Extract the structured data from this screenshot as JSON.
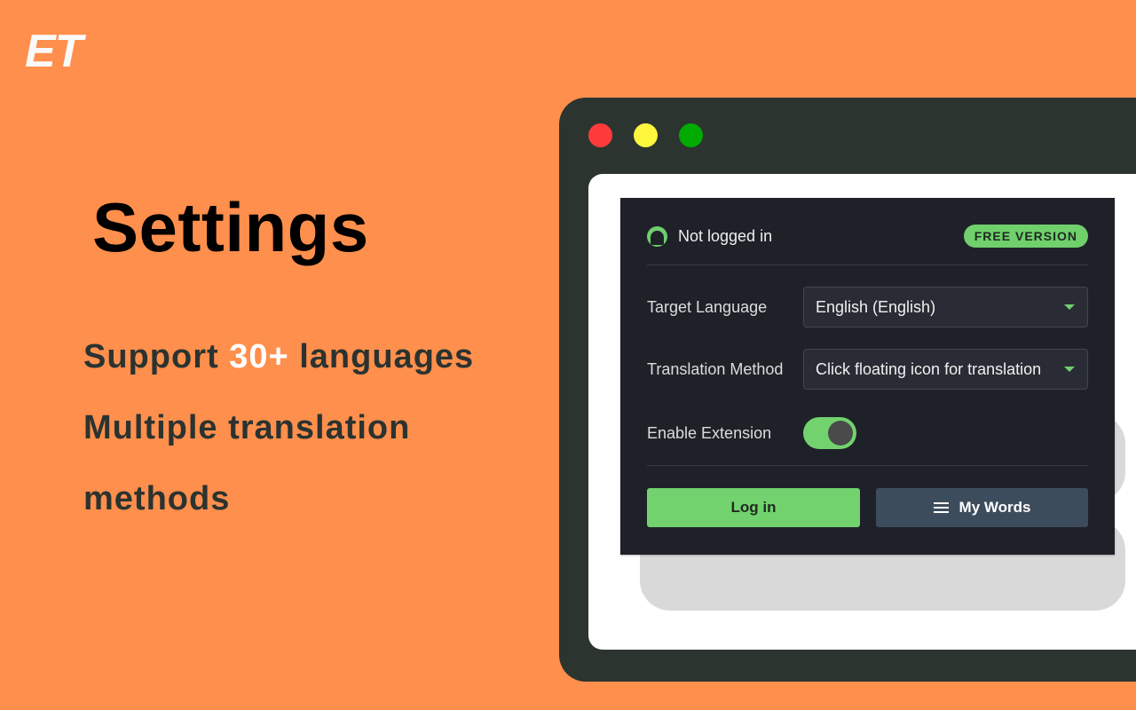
{
  "brand": {
    "logo_text": "ET",
    "background_color": "#ff8f4c"
  },
  "hero": {
    "title": "Settings",
    "features": [
      {
        "before": "Support ",
        "highlight": "30+",
        "after": " languages"
      },
      {
        "text": "Multiple translation methods"
      }
    ]
  },
  "browser": {
    "window_controls": [
      "close",
      "minimize",
      "maximize"
    ]
  },
  "popup": {
    "account": {
      "status": "Not logged in",
      "badge": "FREE VERSION",
      "icon": "user-avatar-icon"
    },
    "settings": {
      "target_language": {
        "label": "Target Language",
        "value": "English (English)"
      },
      "translation_method": {
        "label": "Translation Method",
        "value": "Click floating icon for translation"
      },
      "enable_extension": {
        "label": "Enable Extension",
        "enabled": true
      }
    },
    "buttons": {
      "login": "Log in",
      "my_words": "My Words",
      "my_words_icon": "menu-icon"
    },
    "colors": {
      "accent": "#72d36e",
      "panel": "#1f2129",
      "secondary_button": "#3d4c5c"
    }
  }
}
